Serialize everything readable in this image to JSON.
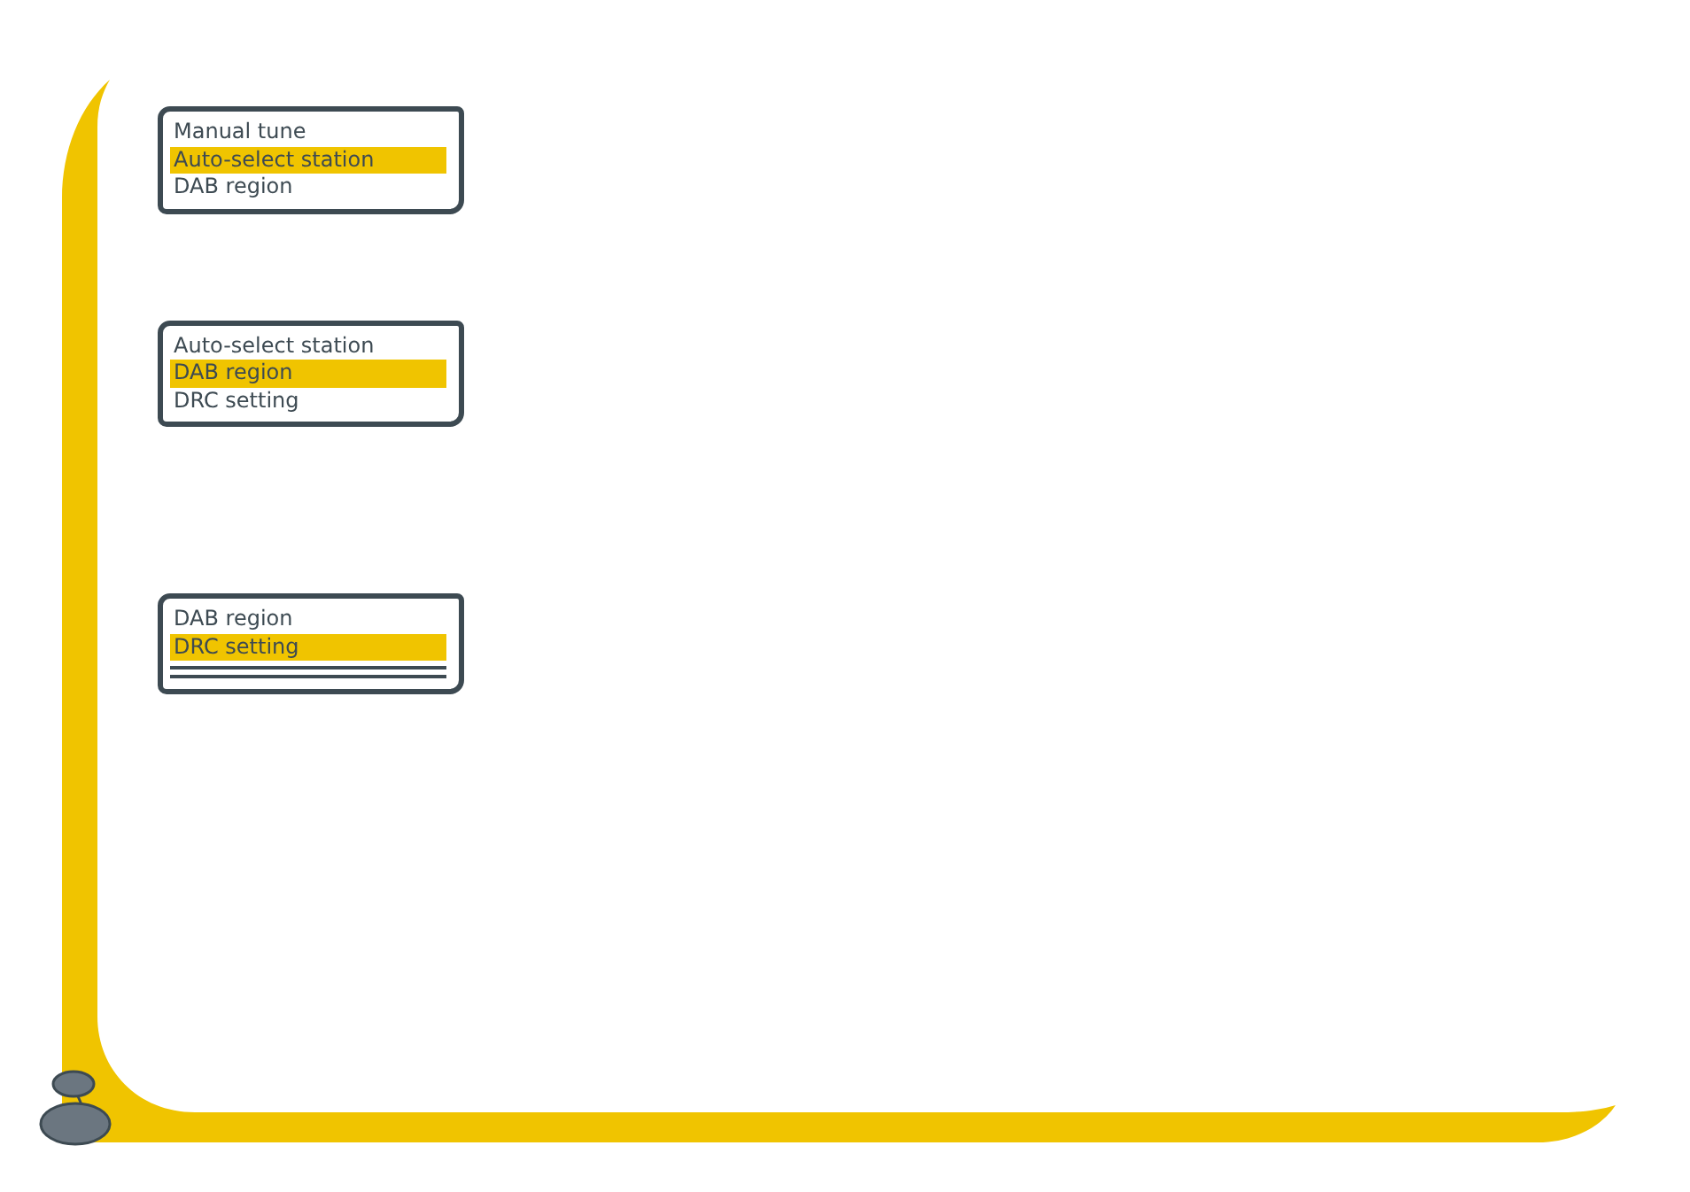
{
  "displays": [
    {
      "items": [
        {
          "label": "Manual tune",
          "selected": false
        },
        {
          "label": "Auto-select station",
          "selected": true
        },
        {
          "label": "DAB region",
          "selected": false
        }
      ],
      "end_of_list": false
    },
    {
      "items": [
        {
          "label": "Auto-select station",
          "selected": false
        },
        {
          "label": "DAB region",
          "selected": true
        },
        {
          "label": "DRC setting",
          "selected": false
        }
      ],
      "end_of_list": false
    },
    {
      "items": [
        {
          "label": "DAB region",
          "selected": false
        },
        {
          "label": "DRC setting",
          "selected": true
        }
      ],
      "end_of_list": true
    }
  ]
}
